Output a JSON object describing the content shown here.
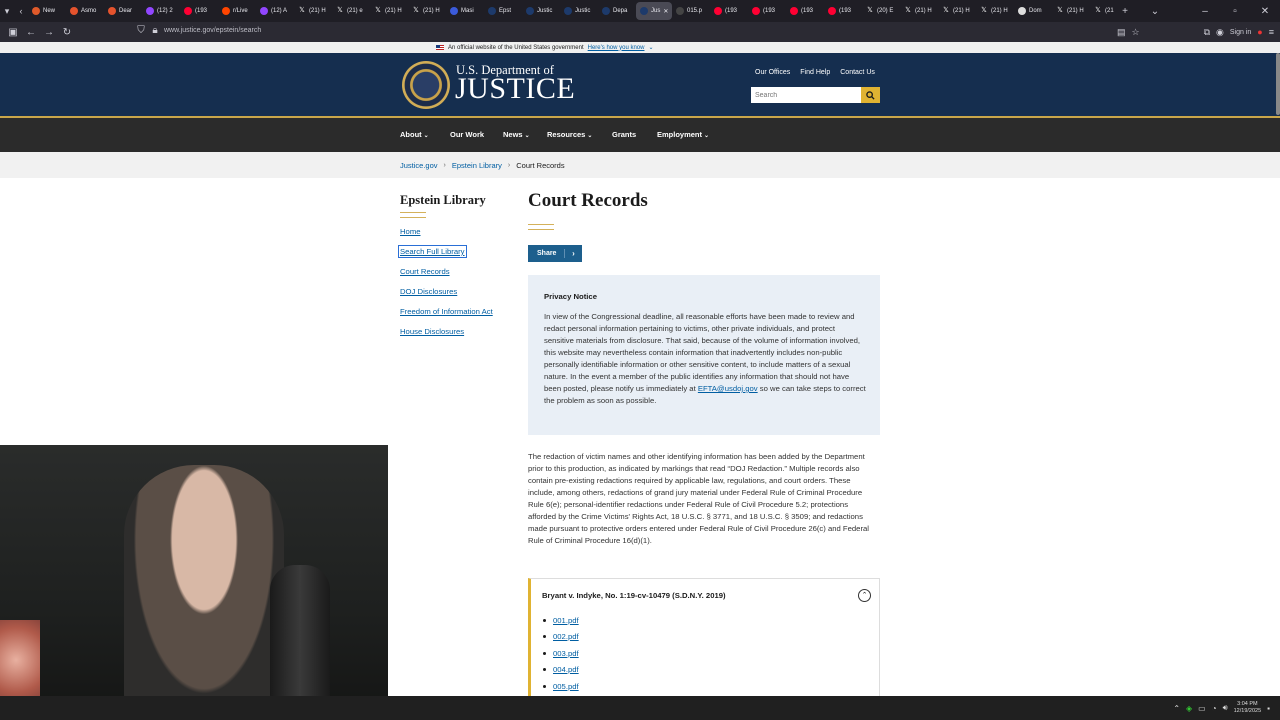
{
  "browser": {
    "tabs": [
      {
        "label": "New",
        "color": "#e05a2a"
      },
      {
        "label": "Asmo",
        "color": "#e5532d"
      },
      {
        "label": "Dear",
        "color": "#e5532d"
      },
      {
        "label": "(12) 2",
        "color": "#9146ff"
      },
      {
        "label": "(193",
        "color": "#ff0033"
      },
      {
        "label": "r/Live",
        "color": "#ff4500"
      },
      {
        "label": "(12) A",
        "color": "#9146ff"
      },
      {
        "label": "(21) H",
        "color": "x"
      },
      {
        "label": "(21) e",
        "color": "x"
      },
      {
        "label": "(21) H",
        "color": "x"
      },
      {
        "label": "(21) H",
        "color": "x"
      },
      {
        "label": "Masi",
        "color": "#3b5bdb"
      },
      {
        "label": "Epst",
        "color": "#1d3a6b"
      },
      {
        "label": "Justic",
        "color": "#1d3a6b"
      },
      {
        "label": "Justic",
        "color": "#1d3a6b"
      },
      {
        "label": "Depa",
        "color": "#1d3a6b"
      },
      {
        "label": "Jus",
        "color": "#1d3a6b",
        "active": true
      },
      {
        "label": "015.p",
        "color": "#444"
      },
      {
        "label": "(193",
        "color": "#ff0033"
      },
      {
        "label": "(193",
        "color": "#ff0033"
      },
      {
        "label": "(193",
        "color": "#ff0033"
      },
      {
        "label": "(193",
        "color": "#ff0033"
      },
      {
        "label": "(20) E",
        "color": "x"
      },
      {
        "label": "(21) H",
        "color": "x"
      },
      {
        "label": "(21) H",
        "color": "x"
      },
      {
        "label": "(21) H",
        "color": "x"
      },
      {
        "label": "Dom",
        "color": "#ddd"
      },
      {
        "label": "(21) H",
        "color": "x"
      },
      {
        "label": "(21",
        "color": "x"
      }
    ],
    "url": "www.justice.gov/epstein/search",
    "signin_label": "Sign in"
  },
  "gov_banner": {
    "text": "An official website of the United States government",
    "link": "Here's how you know"
  },
  "header": {
    "title_top": "U.S. Department of",
    "title_main": "JUSTICE",
    "util_links": [
      "Our Offices",
      "Find Help",
      "Contact Us"
    ],
    "search_placeholder": "Search"
  },
  "nav": [
    "About",
    "Our Work",
    "News",
    "Resources",
    "Grants",
    "Employment"
  ],
  "breadcrumb": [
    "Justice.gov",
    "Epstein Library",
    "Court Records"
  ],
  "sidebar": {
    "title": "Epstein Library",
    "links": [
      "Home",
      "Search Full Library",
      "Court Records",
      "DOJ Disclosures",
      "Freedom of Information Act",
      "House Disclosures"
    ]
  },
  "main": {
    "title": "Court Records",
    "share_label": "Share",
    "privacy_title": "Privacy Notice",
    "privacy_text_before": "In view of the Congressional deadline, all reasonable efforts have been made to review and redact personal information pertaining to victims, other private individuals, and protect sensitive materials from disclosure.  That said, because of the volume of information involved, this website may nevertheless contain information that inadvertently includes non-public personally identifiable information or other sensitive content, to include matters of a sexual nature.  In the event a member of the public identifies any information that should not have been posted, please notify us immediately at",
    "privacy_email": "EFTA@usdoj.gov",
    "privacy_text_after": "so we can take steps to correct the problem as soon as possible.",
    "body_text": "The redaction of victim names and other identifying information has been added by the Department prior to this production, as indicated by markings that read “DOJ Redaction.” Multiple records also contain pre-existing redactions required by applicable law, regulations, and court orders. These include, among others, redactions of grand jury material under Federal Rule of Criminal Procedure Rule 6(e); personal-identifier redactions under Federal Rule of Civil Procedure 5.2; protections afforded by the Crime Victims' Rights Act, 18 U.S.C. § 3771, and 18 U.S.C. § 3509; and redactions made pursuant to protective orders entered under Federal Rule of Civil Procedure 26(c) and Federal Rule of Criminal Procedure 16(d)(1).",
    "accordion_title": "Bryant v. Indyke, No. 1:19-cv-10479 (S.D.N.Y. 2019)",
    "files": [
      "001.pdf",
      "002.pdf",
      "003.pdf",
      "004.pdf",
      "005.pdf"
    ]
  },
  "taskbar": {
    "time": "3:04 PM",
    "date": "12/19/2025"
  }
}
